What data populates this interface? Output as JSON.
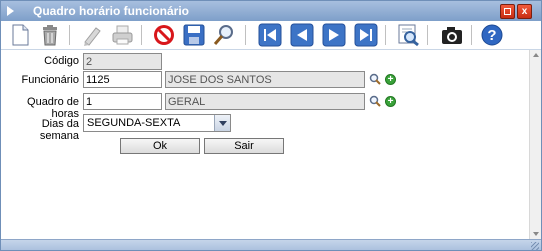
{
  "window": {
    "title": "Quadro horário funcionário"
  },
  "titlebar_buttons": {
    "maximize": "maximize",
    "close": "x"
  },
  "toolbar": {
    "icons": [
      "new-document-icon",
      "delete-trash-icon",
      "edit-pencil-icon",
      "print-icon",
      "cancel-icon",
      "save-disk-icon",
      "search-magnifier-icon",
      "first-record-icon",
      "previous-record-icon",
      "next-record-icon",
      "last-record-icon",
      "report-preview-icon",
      "camera-icon",
      "help-icon"
    ]
  },
  "form": {
    "codigo": {
      "label": "Código",
      "value": "2"
    },
    "funcionario": {
      "label": "Funcionário",
      "value": "1125",
      "description": "JOSE DOS SANTOS"
    },
    "quadro_horas": {
      "label": "Quadro de horas",
      "value": "1",
      "description": "GERAL"
    },
    "dias_semana": {
      "label": "Dias da semana",
      "value": "SEGUNDA-SEXTA"
    },
    "ok_label": "Ok",
    "sair_label": "Sair"
  },
  "colors": {
    "title_bar": "#8aa9d3",
    "close_button": "#e14a2c",
    "add_icon": "#3aa23a"
  }
}
